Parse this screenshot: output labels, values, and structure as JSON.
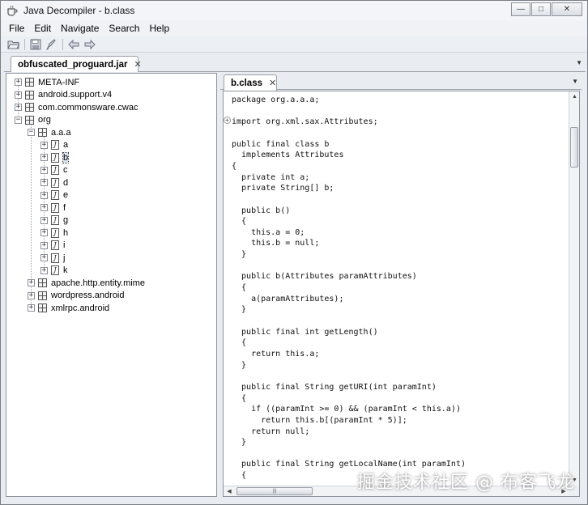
{
  "window": {
    "title": "Java Decompiler - b.class",
    "controls": {
      "minimize": "—",
      "maximize": "□",
      "close": "✕"
    }
  },
  "menubar": {
    "items": [
      "File",
      "Edit",
      "Navigate",
      "Search",
      "Help"
    ]
  },
  "toolbar": {
    "icons": [
      "open-folder-icon",
      "save-icon",
      "rocket-icon",
      "back-arrow-icon",
      "forward-arrow-icon"
    ]
  },
  "jar_tab": {
    "label": "obfuscated_proguard.jar",
    "close": "✕"
  },
  "tree": {
    "nodes": [
      {
        "label": "META-INF",
        "type": "package",
        "expander": "+",
        "selected": false
      },
      {
        "label": "android.support.v4",
        "type": "package",
        "expander": "+",
        "selected": false
      },
      {
        "label": "com.commonsware.cwac",
        "type": "package",
        "expander": "+",
        "selected": false
      },
      {
        "label": "org",
        "type": "package",
        "expander": "−",
        "selected": false
      },
      {
        "label": "a.a.a",
        "type": "package",
        "expander": "−",
        "selected": false
      },
      {
        "label": "a",
        "type": "class",
        "expander": "+",
        "selected": false
      },
      {
        "label": "b",
        "type": "class",
        "expander": "+",
        "selected": true
      },
      {
        "label": "c",
        "type": "class",
        "expander": "+",
        "selected": false
      },
      {
        "label": "d",
        "type": "class",
        "expander": "+",
        "selected": false
      },
      {
        "label": "e",
        "type": "class",
        "expander": "+",
        "selected": false
      },
      {
        "label": "f",
        "type": "class",
        "expander": "+",
        "selected": false
      },
      {
        "label": "g",
        "type": "class",
        "expander": "+",
        "selected": false
      },
      {
        "label": "h",
        "type": "class",
        "expander": "+",
        "selected": false
      },
      {
        "label": "i",
        "type": "class",
        "expander": "+",
        "selected": false
      },
      {
        "label": "j",
        "type": "class",
        "expander": "+",
        "selected": false
      },
      {
        "label": "k",
        "type": "class",
        "expander": "+",
        "selected": false
      },
      {
        "label": "apache.http.entity.mime",
        "type": "package",
        "expander": "+",
        "selected": false
      },
      {
        "label": "wordpress.android",
        "type": "package",
        "expander": "+",
        "selected": false
      },
      {
        "label": "xmlrpc.android",
        "type": "package",
        "expander": "+",
        "selected": false
      }
    ]
  },
  "editor_tab": {
    "label": "b.class",
    "close": "✕"
  },
  "code": {
    "gutter_marker": "+",
    "lines": [
      "package org.a.a.a;",
      "",
      "import org.xml.sax.Attributes;",
      "",
      "public final class b",
      "  implements Attributes",
      "{",
      "  private int a;",
      "  private String[] b;",
      "",
      "  public b()",
      "  {",
      "    this.a = 0;",
      "    this.b = null;",
      "  }",
      "",
      "  public b(Attributes paramAttributes)",
      "  {",
      "    a(paramAttributes);",
      "  }",
      "",
      "  public final int getLength()",
      "  {",
      "    return this.a;",
      "  }",
      "",
      "  public final String getURI(int paramInt)",
      "  {",
      "    if ((paramInt >= 0) && (paramInt < this.a))",
      "      return this.b[(paramInt * 5)];",
      "    return null;",
      "  }",
      "",
      "  public final String getLocalName(int paramInt)",
      "  {"
    ]
  },
  "scrollbars": {
    "up": "▲",
    "down": "▼",
    "left": "◀",
    "right": "▶",
    "grip": "|||"
  },
  "watermark": "掘金技术社区 @ 布客飞龙"
}
